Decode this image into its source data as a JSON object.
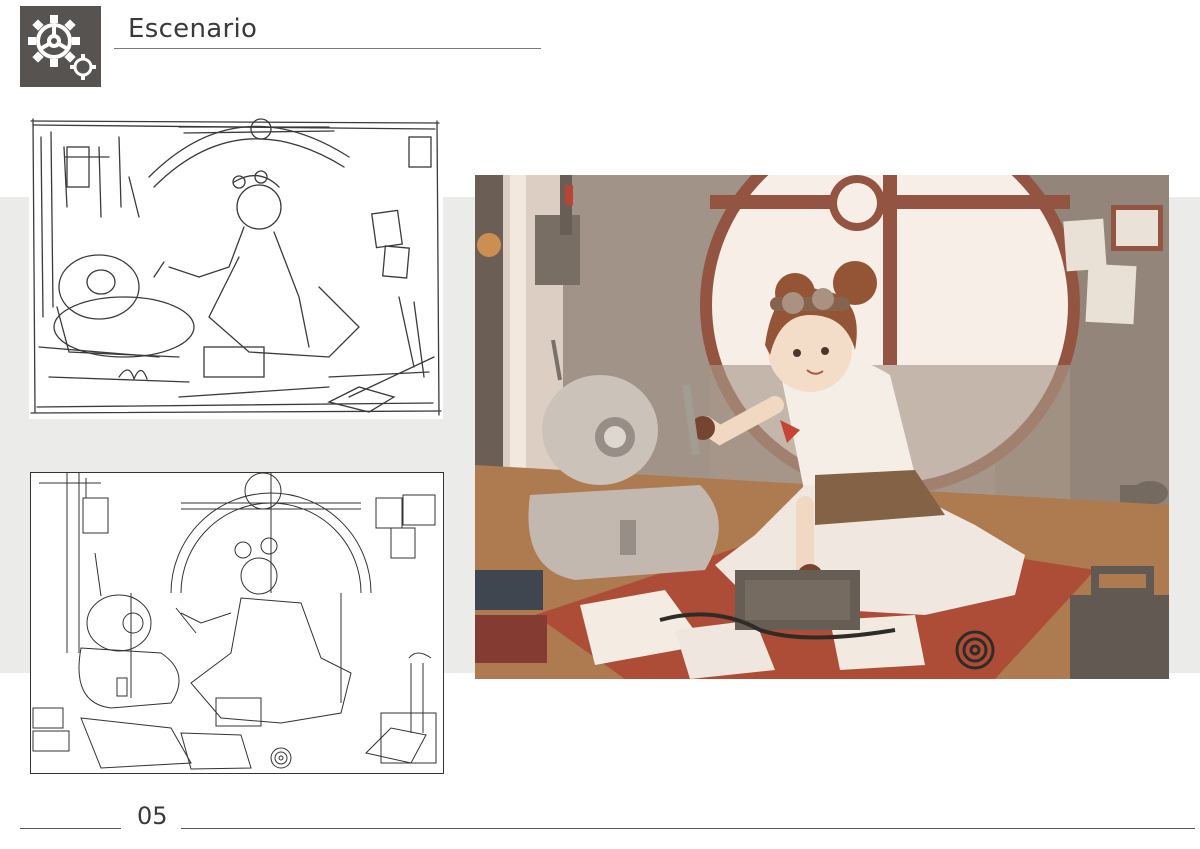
{
  "header": {
    "logo_icon": "gear-icon",
    "title": "Escenario"
  },
  "panels": [
    {
      "name": "rough-sketch",
      "style": "pencil rough sketch"
    },
    {
      "name": "clean-lineart",
      "style": "clean line art"
    },
    {
      "name": "color-illustration",
      "style": "full color illustration"
    }
  ],
  "footer": {
    "page_number": "05"
  },
  "colors": {
    "logo_background": "#575350",
    "band_background": "#ebebea",
    "floor_rug": "#a8432f",
    "wall": "#8c8178",
    "window_frame": "#8a4a3a",
    "hair": "#8a4b2e"
  }
}
